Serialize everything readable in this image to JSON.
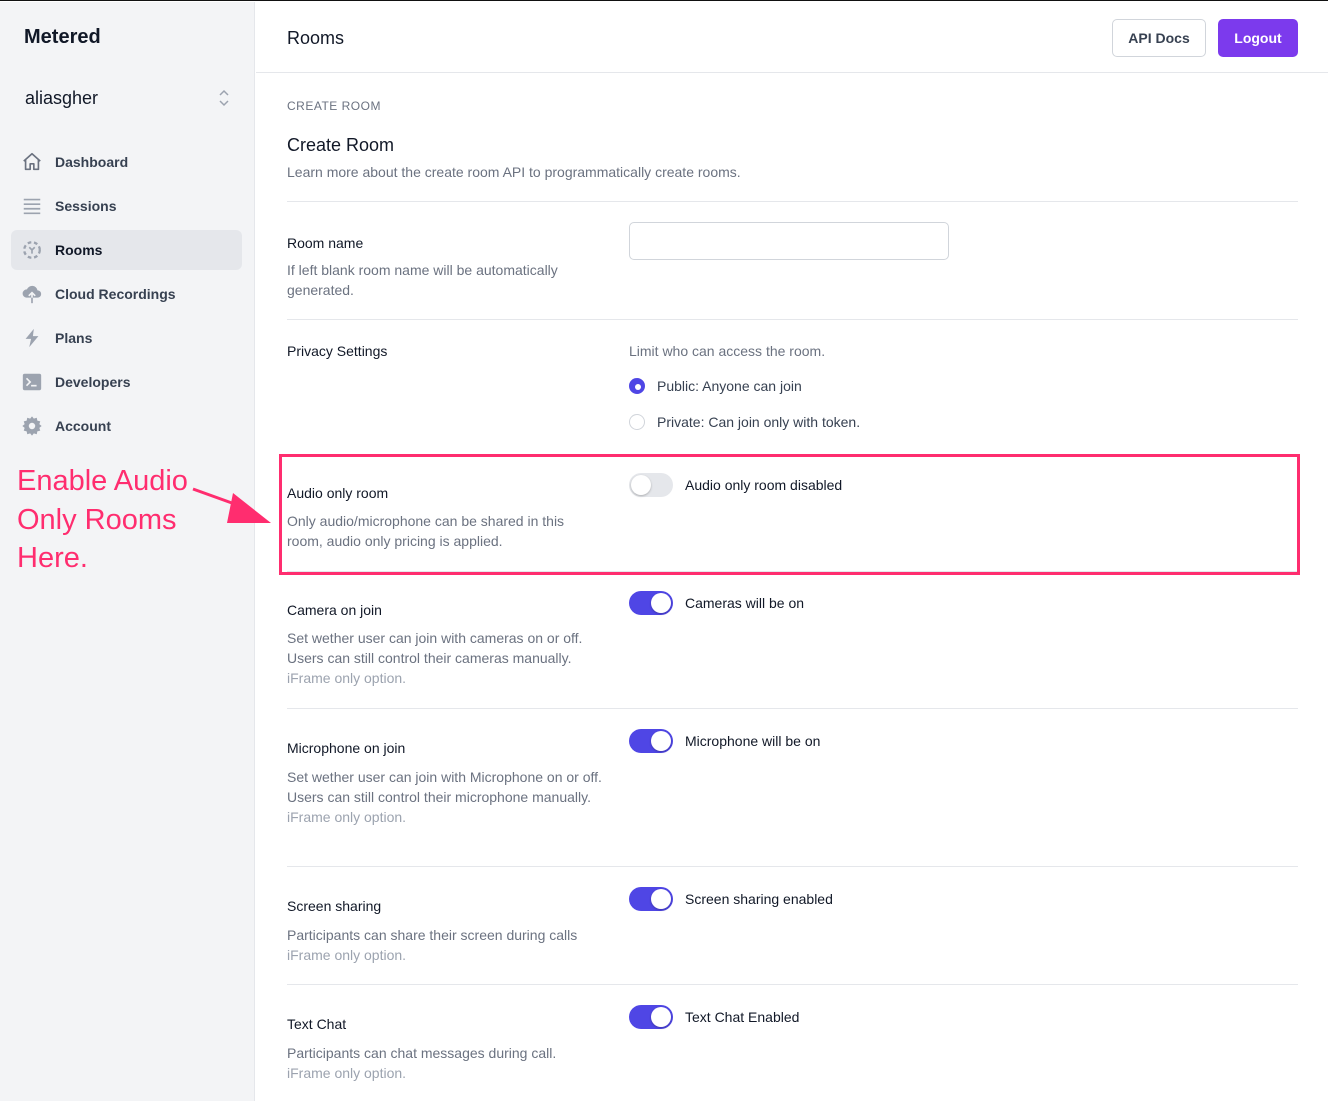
{
  "sidebar": {
    "brand": "Metered",
    "account": {
      "name": "aliasgher",
      "icon": "chevron-up-down-icon"
    },
    "items": [
      {
        "label": "Dashboard",
        "icon": "home-icon",
        "active": false
      },
      {
        "label": "Sessions",
        "icon": "menu-lines-icon",
        "active": false
      },
      {
        "label": "Rooms",
        "icon": "rooms-icon",
        "active": true
      },
      {
        "label": "Cloud Recordings",
        "icon": "cloud-upload-icon",
        "active": false
      },
      {
        "label": "Plans",
        "icon": "lightning-icon",
        "active": false
      },
      {
        "label": "Developers",
        "icon": "terminal-icon",
        "active": false
      },
      {
        "label": "Account",
        "icon": "gear-icon",
        "active": false
      }
    ]
  },
  "annotation": {
    "text": "Enable Audio Only Rooms Here.",
    "color": "#ff2d6f"
  },
  "header": {
    "title": "Rooms",
    "api_docs_label": "API Docs",
    "logout_label": "Logout",
    "accent": "#7c3aed"
  },
  "main": {
    "eyebrow": "CREATE ROOM",
    "title": "Create Room",
    "subtitle": "Learn more about the create room API to programmatically create rooms.",
    "room_name": {
      "label": "Room name",
      "description": "If left blank room name will be automatically generated.",
      "value": "",
      "placeholder": ""
    },
    "privacy": {
      "label": "Privacy Settings",
      "help": "Limit who can access the room.",
      "options": [
        {
          "label": "Public: Anyone can join",
          "checked": true
        },
        {
          "label": "Private: Can join only with token.",
          "checked": false
        }
      ]
    },
    "audio_only": {
      "label": "Audio only room",
      "description": "Only audio/microphone can be shared in this room, audio only pricing is applied.",
      "enabled": false,
      "status": "Audio only room disabled"
    },
    "camera": {
      "label": "Camera on join",
      "description": "Set wether user can join with cameras on or off. Users can still control their cameras manually.",
      "note": "iFrame only option.",
      "enabled": true,
      "status": "Cameras will be on"
    },
    "microphone": {
      "label": "Microphone on join",
      "description": "Set wether user can join with Microphone on or off. Users can still control their microphone manually.",
      "note": "iFrame only option.",
      "enabled": true,
      "status": "Microphone will be on"
    },
    "screen_sharing": {
      "label": "Screen sharing",
      "description": "Participants can share their screen during calls",
      "note": "iFrame only option.",
      "enabled": true,
      "status": "Screen sharing enabled"
    },
    "text_chat": {
      "label": "Text Chat",
      "description": "Participants can chat messages during call.",
      "note": "iFrame only option.",
      "enabled": true,
      "status": "Text Chat Enabled"
    }
  },
  "colors": {
    "toggle_on": "#4f46e5",
    "toggle_off": "#e5e7eb",
    "highlight": "#ff2d6f"
  }
}
